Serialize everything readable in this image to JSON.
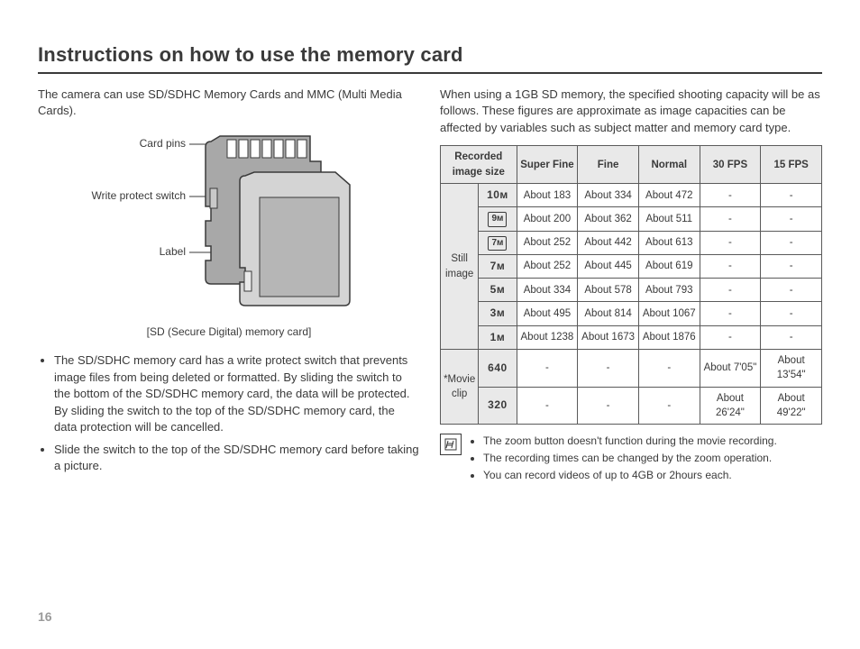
{
  "title": "Instructions on how to use the memory card",
  "page_number": "16",
  "left": {
    "intro": "The camera can use SD/SDHC Memory Cards and MMC (Multi Media Cards).",
    "labels": {
      "pins": "Card pins",
      "wps": "Write protect switch",
      "label": "Label"
    },
    "caption": "[SD (Secure Digital) memory card]",
    "bullets": [
      "The SD/SDHC memory card has a write protect switch that prevents image files from being deleted or formatted. By sliding the switch to the bottom of the SD/SDHC memory card, the data will be protected. By sliding the switch to the top of the SD/SDHC memory card, the data protection will be cancelled.",
      "Slide the switch to the top of the SD/SDHC memory card before taking a picture."
    ]
  },
  "right": {
    "intro": "When using a 1GB SD memory, the specified shooting capacity will be as follows. These figures are approximate as image capacities can be affected by variables such as subject matter and memory card type.",
    "headers": {
      "recorded": "Recorded image size",
      "super_fine": "Super Fine",
      "fine": "Fine",
      "normal": "Normal",
      "fps30": "30 FPS",
      "fps15": "15 FPS"
    },
    "group_still": "Still image",
    "group_movie": "*Movie clip",
    "still_rows": [
      {
        "size": "10ᴍ",
        "box": false,
        "sf": "About 183",
        "f": "About 334",
        "n": "About 472",
        "a": "-",
        "b": "-"
      },
      {
        "size": "9ᴍ",
        "box": true,
        "sf": "About 200",
        "f": "About 362",
        "n": "About 511",
        "a": "-",
        "b": "-"
      },
      {
        "size": "7ᴍ",
        "box": true,
        "sf": "About 252",
        "f": "About 442",
        "n": "About 613",
        "a": "-",
        "b": "-"
      },
      {
        "size": "7ᴍ",
        "box": false,
        "sf": "About 252",
        "f": "About 445",
        "n": "About 619",
        "a": "-",
        "b": "-"
      },
      {
        "size": "5ᴍ",
        "box": false,
        "sf": "About 334",
        "f": "About 578",
        "n": "About 793",
        "a": "-",
        "b": "-"
      },
      {
        "size": "3ᴍ",
        "box": false,
        "sf": "About 495",
        "f": "About 814",
        "n": "About 1067",
        "a": "-",
        "b": "-"
      },
      {
        "size": "1ᴍ",
        "box": false,
        "sf": "About 1238",
        "f": "About 1673",
        "n": "About 1876",
        "a": "-",
        "b": "-"
      }
    ],
    "movie_rows": [
      {
        "size": "640",
        "sf": "-",
        "f": "-",
        "n": "-",
        "a": "About 7'05\"",
        "b": "About 13'54\""
      },
      {
        "size": "320",
        "sf": "-",
        "f": "-",
        "n": "-",
        "a": "About 26'24\"",
        "b": "About 49'22\""
      }
    ],
    "notes": [
      "The zoom button doesn't function during the movie recording.",
      "The recording times can be changed by the zoom operation.",
      "You can record videos of up to 4GB or 2hours each."
    ]
  }
}
